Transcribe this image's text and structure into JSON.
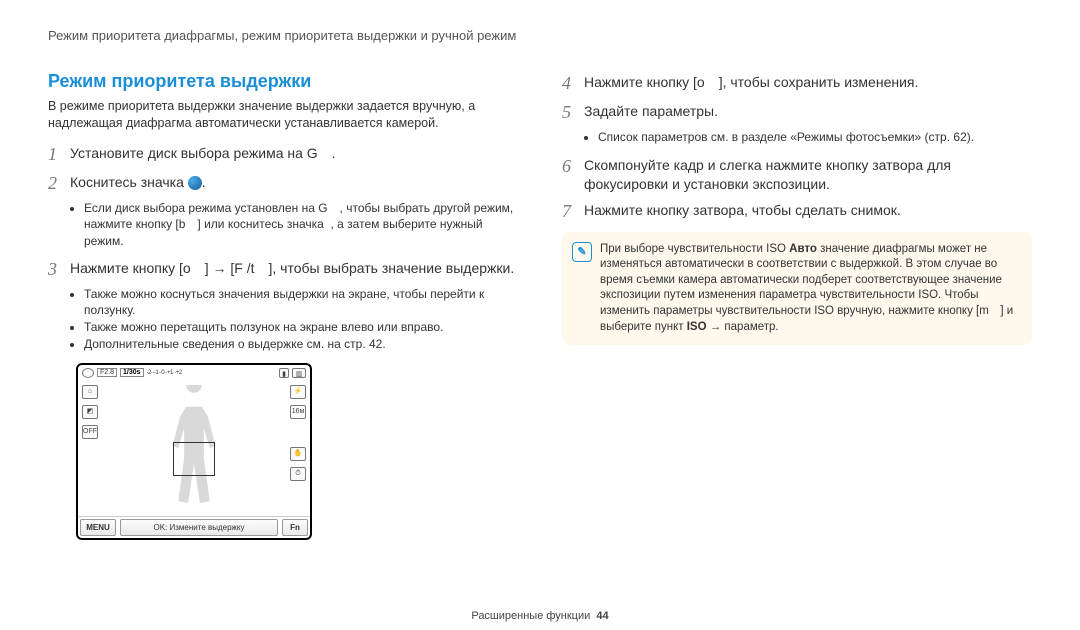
{
  "header": "Режим приоритета диафрагмы, режим приоритета выдержки и ручной режим",
  "section_title": "Режим приоритета выдержки",
  "intro": "В режиме приоритета выдержки значение выдержки задается вручную, а надлежащая диафрагма автоматически устанавливается камерой.",
  "left_steps": {
    "s1": "Установите диск выбора режима на G .",
    "s2_pre": "Коснитесь значка ",
    "s2_post": ".",
    "s2_bullets": [
      "Если диск выбора режима установлен на G , чтобы выбрать другой режим, нажмите кнопку [b ] или коснитесь значка  , а затем выберите нужный режим."
    ],
    "s3": "Нажмите кнопку [o ] → [F /t ], чтобы выбрать значение выдержки.",
    "s3_bullets": [
      "Также можно коснуться значения выдержки на экране, чтобы перейти к ползунку.",
      "Также можно перетащить ползунок на экране влево или вправо.",
      "Дополнительные сведения о выдержке см. на стр. 42."
    ]
  },
  "right_steps": {
    "s4": "Нажмите кнопку [o ], чтобы сохранить изменения.",
    "s5": "Задайте параметры.",
    "s5_bullets": [
      "Список параметров см. в разделе «Режимы фотосъемки» (стр. 62)."
    ],
    "s6": "Скомпонуйте кадр и слегка нажмите кнопку затвора для фокусировки и установки экспозиции.",
    "s7": "Нажмите кнопку затвора, чтобы сделать снимок."
  },
  "note": {
    "text_pre": "При выборе чувствительности ISO ",
    "bold1": "Авто",
    "text_mid": " значение диафрагмы может не изменяться автоматически в соответствии с выдержкой. В этом случае во время съемки камера автоматически подберет соответствующее значение экспозиции путем изменения параметра чувствительности ISO. Чтобы изменить параметры чувствительности ISO вручную, нажмите кнопку [m ] и выберите пункт ",
    "bold2": "ISO",
    "text_post": " → параметр."
  },
  "camera": {
    "f": "F2.8",
    "shutter": "1/30s",
    "ev": "-2··-1··0··+1··+2",
    "menu": "MENU",
    "mid": "OK: Измените выдержку",
    "fn": "Fn"
  },
  "footer": {
    "label": "Расширенные функции",
    "page": "44"
  }
}
